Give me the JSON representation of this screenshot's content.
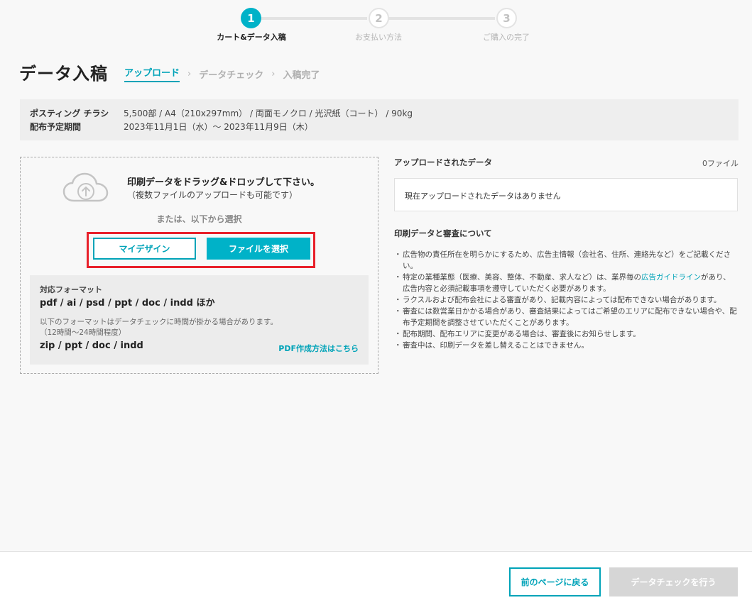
{
  "stepper": {
    "steps": [
      {
        "number": "1",
        "label": "カート&データ入稿",
        "state": "active"
      },
      {
        "number": "2",
        "label": "お支払い方法",
        "state": "inactive"
      },
      {
        "number": "3",
        "label": "ご購入の完了",
        "state": "inactive"
      }
    ]
  },
  "header": {
    "title": "データ入稿",
    "breadcrumb": [
      {
        "label": "アップロード",
        "state": "active"
      },
      {
        "label": "データチェック",
        "state": "inactive"
      },
      {
        "label": "入稿完了",
        "state": "inactive"
      }
    ],
    "separator": "›"
  },
  "order": {
    "product_label": "ポスティング チラシ",
    "product_value": "5,500部 /  A4（210x297mm） / 両面モノクロ / 光沢紙（コート） / 90kg",
    "period_label": "配布予定期間",
    "period_value": "2023年11月1日（水）～ 2023年11月9日（木）"
  },
  "dropzone": {
    "icon": "cloud-upload-icon",
    "main_text": "印刷データをドラッグ&ドロップして下さい。",
    "sub_text": "（複数ファイルのアップロードも可能です）",
    "or_text": "または、以下から選択",
    "my_design_button": "マイデザイン",
    "select_file_button": "ファイルを選択",
    "formats": {
      "label": "対応フォーマット",
      "list": "pdf / ai / psd / ppt / doc / indd ほか",
      "note_line1": "以下のフォーマットはデータチェックに時間が掛かる場合があります。",
      "note_line2": "（12時間～24時間程度）",
      "slow_list": "zip / ppt / doc / indd",
      "pdf_link": "PDF作成方法はこちら"
    }
  },
  "uploaded": {
    "title": "アップロードされたデータ",
    "count": "0ファイル",
    "empty_text": "現在アップロードされたデータはありません"
  },
  "review": {
    "title": "印刷データと審査について",
    "items": [
      "広告物の責任所在を明らかにするため、広告主情報（会社名、住所、連絡先など）をご記載ください。",
      "特定の業種業態（医療、美容、整体、不動産、求人など）は、業界毎の",
      "ラクスルおよび配布会社による審査があり、記載内容によっては配布できない場合があります。",
      "審査には数営業日かかる場合があり、審査結果によってはご希望のエリアに配布できない場合や、配布予定期間を調整させていただくことがあります。",
      "配布期間、配布エリアに変更がある場合は、審査後にお知らせします。",
      "審査中は、印刷データを差し替えることはできません。"
    ],
    "item2_link": "広告ガイドライン",
    "item2_rest": "があり、広告内容と必須記載事項を遵守していただく必要があります。",
    "bullet": "・"
  },
  "footer": {
    "back_button": "前のページに戻る",
    "check_button": "データチェックを行う"
  },
  "colors": {
    "accent": "#00b2c8",
    "highlight": "#e8202a",
    "disabled": "#d6d6d6"
  }
}
